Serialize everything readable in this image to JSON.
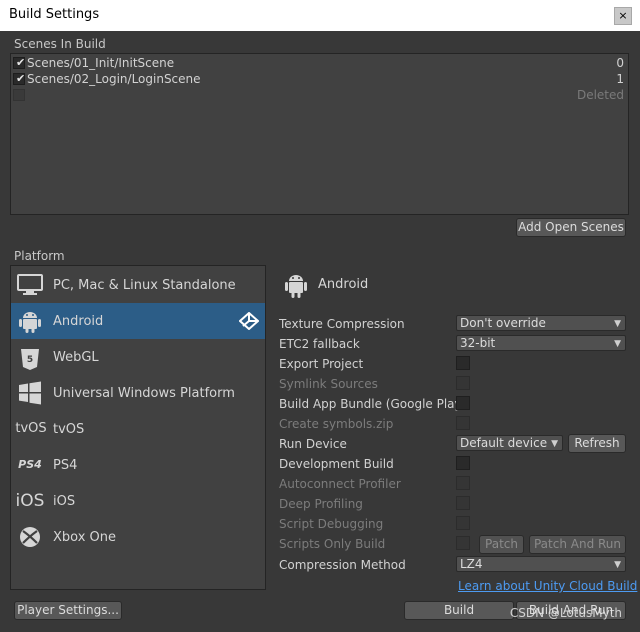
{
  "window": {
    "title": "Build Settings",
    "close_glyph": "×"
  },
  "scenes": {
    "label": "Scenes In Build",
    "items": [
      {
        "name": "Scenes/01_Init/InitScene",
        "index": "0",
        "checked": true
      },
      {
        "name": "Scenes/02_Login/LoginScene",
        "index": "1",
        "checked": true
      },
      {
        "name": "",
        "index": "Deleted",
        "checked": false
      }
    ],
    "add_open_scenes": "Add Open Scenes"
  },
  "platform": {
    "label": "Platform",
    "items": [
      {
        "name": "PC, Mac & Linux Standalone",
        "icon": "monitor-icon"
      },
      {
        "name": "Android",
        "icon": "android-icon",
        "selected": true
      },
      {
        "name": "WebGL",
        "icon": "html5-icon",
        "icon_text": "HTML"
      },
      {
        "name": "Universal Windows Platform",
        "icon": "windows-icon"
      },
      {
        "name": "tvOS",
        "icon": "tvos-icon",
        "icon_text": "tvOS"
      },
      {
        "name": "PS4",
        "icon": "ps4-icon",
        "icon_text": "PS4"
      },
      {
        "name": "iOS",
        "icon": "ios-icon",
        "icon_text": "iOS"
      },
      {
        "name": "Xbox One",
        "icon": "xbox-icon"
      }
    ]
  },
  "android": {
    "title": "Android",
    "texture_compression": {
      "label": "Texture Compression",
      "value": "Don't override"
    },
    "etc2_fallback": {
      "label": "ETC2 fallback",
      "value": "32-bit"
    },
    "export_project": "Export Project",
    "symlink_sources": "Symlink Sources",
    "build_app_bundle": "Build App Bundle (Google Play)",
    "create_symbols_zip": "Create symbols.zip",
    "run_device": {
      "label": "Run Device",
      "value": "Default device",
      "refresh": "Refresh"
    },
    "development_build": "Development Build",
    "autoconnect_profiler": "Autoconnect Profiler",
    "deep_profiling": "Deep Profiling",
    "script_debugging": "Script Debugging",
    "scripts_only_build": {
      "label": "Scripts Only Build",
      "patch": "Patch",
      "patch_and_run": "Patch And Run"
    },
    "compression_method": {
      "label": "Compression Method",
      "value": "LZ4"
    },
    "cloud_link": "Learn about Unity Cloud Build"
  },
  "footer": {
    "player_settings": "Player Settings...",
    "build": "Build",
    "build_and_run": "Build And Run"
  },
  "watermark": "CSDN @LotusMyth",
  "colors": {
    "selection": "#2c5d87",
    "link": "#4d9bf2",
    "background": "#383838"
  }
}
